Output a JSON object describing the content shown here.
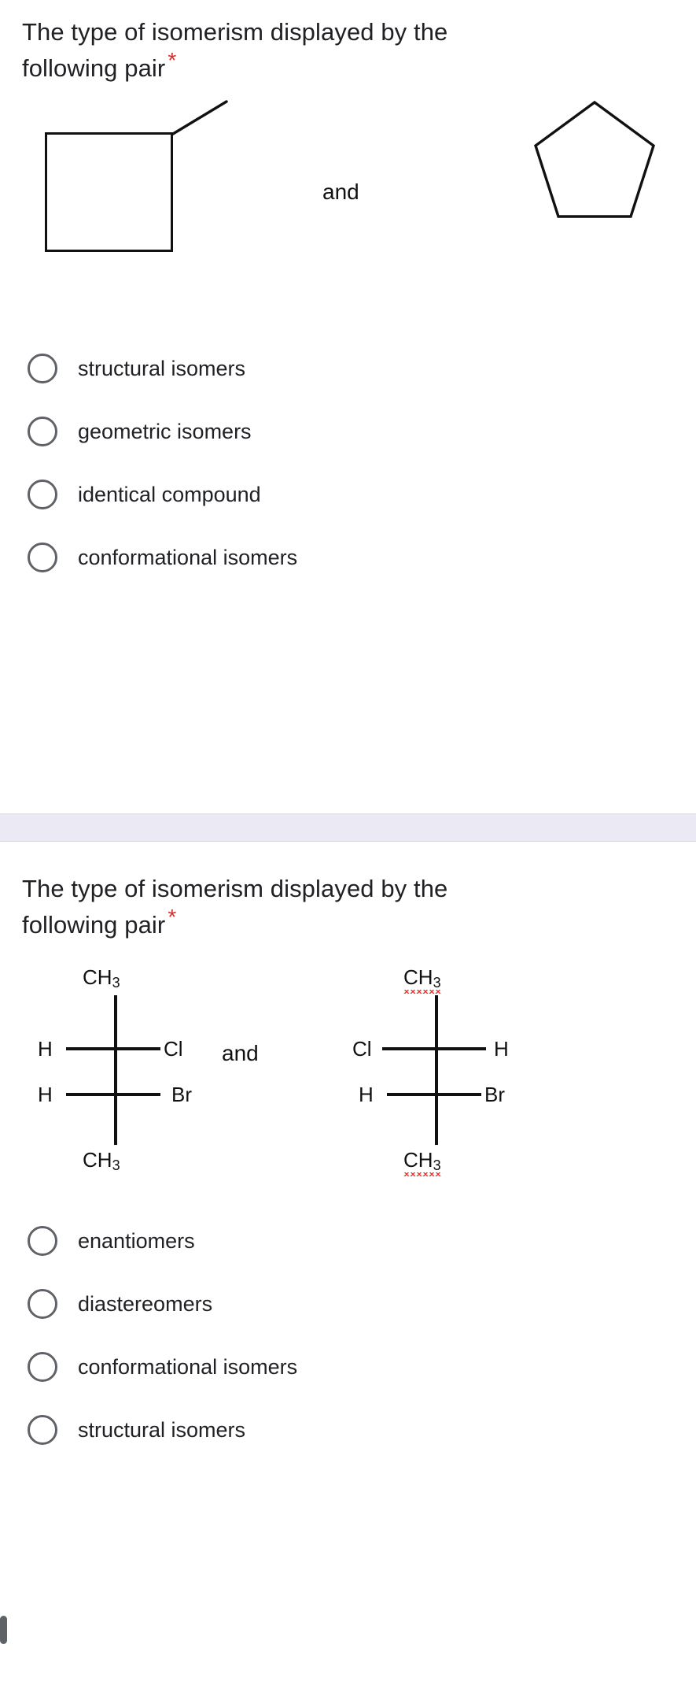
{
  "page": {
    "background_color": "#ffffff",
    "separator_color": "#ebeaf4",
    "required_star_color": "#d93025",
    "spellcheck_underline_color": "#e53935"
  },
  "questions": [
    {
      "title": "The type of isomerism displayed by the",
      "title_line2": "following pair",
      "required_marker": "*",
      "conjunction": "and",
      "structures": [
        {
          "kind": "skeletal",
          "name": "methylcyclobutane",
          "shape": "square-with-methyl-branch",
          "description": "four-membered ring (square) with a methyl substituent drawn as a diagonal line from the top-right vertex"
        },
        {
          "kind": "skeletal",
          "name": "cyclopentane",
          "shape": "pentagon",
          "description": "regular five-membered ring"
        }
      ],
      "options": [
        {
          "label": "structural isomers",
          "selected": false
        },
        {
          "label": "geometric isomers",
          "selected": false
        },
        {
          "label": "identical compound",
          "selected": false
        },
        {
          "label": "conformational isomers",
          "selected": false
        }
      ]
    },
    {
      "title": "The type of isomerism displayed by the",
      "title_line2": "following pair",
      "required_marker": "*",
      "conjunction": "and",
      "structures": [
        {
          "kind": "fischer-projection",
          "top": "CH3",
          "bottom": "CH3",
          "row1_left": "H",
          "row1_right": "Cl",
          "row2_left": "H",
          "row2_right": "Br",
          "spellcheck_top": false,
          "spellcheck_bottom": false
        },
        {
          "kind": "fischer-projection",
          "top": "CH3",
          "bottom": "CH3",
          "row1_left": "Cl",
          "row1_right": "H",
          "row2_left": "H",
          "row2_right": "Br",
          "spellcheck_top": true,
          "spellcheck_bottom": true
        }
      ],
      "options": [
        {
          "label": "enantiomers",
          "selected": false
        },
        {
          "label": "diastereomers",
          "selected": false
        },
        {
          "label": "conformational isomers",
          "selected": false
        },
        {
          "label": "structural isomers",
          "selected": false
        }
      ]
    }
  ]
}
